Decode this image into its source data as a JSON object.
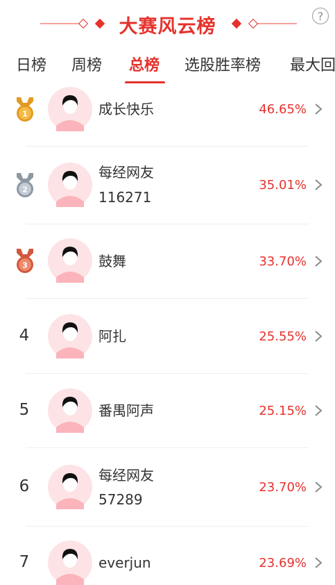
{
  "header": {
    "title": "大赛风云榜",
    "help_label": "?"
  },
  "tabs": [
    {
      "label": "日榜"
    },
    {
      "label": "周榜"
    },
    {
      "label": "总榜",
      "active": true
    },
    {
      "label": "选股胜率榜"
    },
    {
      "label": "最大回"
    }
  ],
  "medals": {
    "gold": "1",
    "silver": "2",
    "bronze": "3"
  },
  "rows": [
    {
      "rank": "1",
      "medal": "gold",
      "name": "成长快乐",
      "rate": "46.65%"
    },
    {
      "rank": "2",
      "medal": "silver",
      "name": "每经网友",
      "name2": "116271",
      "rate": "35.01%"
    },
    {
      "rank": "3",
      "medal": "bronze",
      "name": "鼓舞",
      "rate": "33.70%"
    },
    {
      "rank": "4",
      "name": "阿扎",
      "rate": "25.55%"
    },
    {
      "rank": "5",
      "name": "番禺阿声",
      "rate": "25.15%"
    },
    {
      "rank": "6",
      "name": "每经网友",
      "name2": "57289",
      "rate": "23.70%"
    },
    {
      "rank": "7",
      "name": "everjun",
      "rate": "23.69%"
    }
  ],
  "colors": {
    "accent": "#e5322d",
    "gold": "#e39a22",
    "silver": "#8d98a4",
    "bronze": "#d2573d"
  }
}
